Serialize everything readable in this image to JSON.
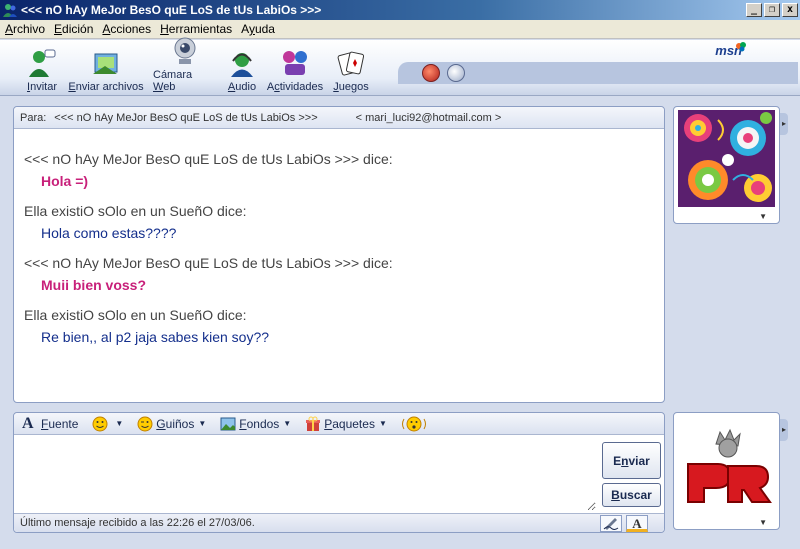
{
  "window": {
    "title": "<<< nO hAy MeJor BesO quE LoS de tUs LabiOs >>>",
    "minimize": "_",
    "maximize": "❐",
    "close": "x"
  },
  "menu": [
    {
      "pre": "",
      "acc": "A",
      "post": "rchivo"
    },
    {
      "pre": "",
      "acc": "E",
      "post": "dición"
    },
    {
      "pre": "",
      "acc": "A",
      "post": "cciones"
    },
    {
      "pre": "",
      "acc": "H",
      "post": "erramientas"
    },
    {
      "pre": "A",
      "acc": "y",
      "post": "uda"
    }
  ],
  "toolbar": {
    "invite": {
      "pre": "",
      "acc": "I",
      "post": "nvitar"
    },
    "send_files": {
      "pre": "",
      "acc": "E",
      "post": "nviar archivos"
    },
    "webcam": {
      "pre": "Cámara ",
      "acc": "W",
      "post": "eb"
    },
    "audio": {
      "pre": "",
      "acc": "A",
      "post": "udio"
    },
    "activities": {
      "pre": "A",
      "acc": "c",
      "post": "tividades"
    },
    "games": {
      "pre": "",
      "acc": "J",
      "post": "uegos"
    },
    "logo": "msn"
  },
  "conversation": {
    "to_label": "Para:",
    "to_name": "<<< nO hAy MeJor BesO quE LoS de tUs LabiOs >>>",
    "to_email": "< mari_luci92@hotmail.com >",
    "messages": [
      {
        "sender": "<<< nO hAy MeJor BesO quE LoS de tUs LabiOs >>> dice:",
        "text": "Hola =)"
      },
      {
        "sender": "Ella existiO sOlo en un SueñO dice:",
        "text": "Hola como estas????"
      },
      {
        "sender": "<<< nO hAy MeJor BesO quE LoS de tUs LabiOs >>> dice:",
        "text": "Muii bien voss?"
      },
      {
        "sender": "Ella existiO sOlo en un SueñO dice:",
        "text": "Re bien,, al p2 jaja sabes kien soy??"
      }
    ]
  },
  "format_bar": {
    "font": {
      "pre": "",
      "acc": "F",
      "post": "uente"
    },
    "winks": {
      "pre": "",
      "acc": "G",
      "post": "uiños"
    },
    "backgrounds": {
      "pre": "",
      "acc": "F",
      "post": "ondos"
    },
    "packages": {
      "pre": "",
      "acc": "P",
      "post": "aquetes"
    }
  },
  "compose": {
    "value": "",
    "send": {
      "pre": "E",
      "acc": "n",
      "post": "viar"
    },
    "search": {
      "pre": "",
      "acc": "B",
      "post": "uscar"
    },
    "status": "Último mensaje recibido a las 22:26 el 27/03/06.",
    "font_style_label": "A"
  },
  "colors": {
    "own_message": "#c8207a",
    "contact_message": "#142f8c"
  }
}
